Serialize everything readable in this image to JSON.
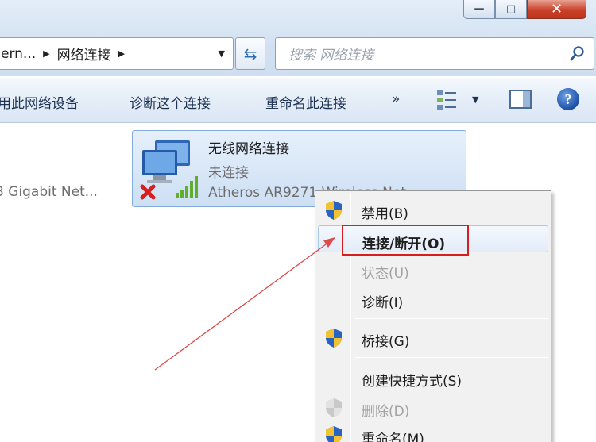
{
  "window": {
    "minimize_glyph": "—",
    "maximize_glyph": "□",
    "close_glyph": "✕"
  },
  "address": {
    "crumb_1": "ern...",
    "crumb_2": "网络连接",
    "dropdown_icon": "chevron-down-icon",
    "refresh_icon": "refresh-icon"
  },
  "search": {
    "placeholder": "搜索 网络连接",
    "icon": "search-icon"
  },
  "commandbar": {
    "items": [
      "用此网络设备",
      "诊断这个连接",
      "重命名此连接"
    ],
    "more": "»",
    "help": "?"
  },
  "content": {
    "left_item_text": "3 Gigabit Net...",
    "selected": {
      "name": "无线网络连接",
      "status": "未连接",
      "adapter": "Atheros AR9271 Wireless Net..."
    }
  },
  "context_menu": {
    "items": [
      {
        "label": "禁用(B)",
        "shield": true,
        "state": "normal"
      },
      {
        "label": "连接/断开(O)",
        "shield": false,
        "state": "default"
      },
      {
        "label": "状态(U)",
        "shield": false,
        "state": "disabled"
      },
      {
        "label": "诊断(I)",
        "shield": false,
        "state": "normal"
      },
      {
        "label": "桥接(G)",
        "shield": true,
        "state": "normal"
      },
      {
        "label": "创建快捷方式(S)",
        "shield": false,
        "state": "normal"
      },
      {
        "label": "删除(D)",
        "shield": true,
        "state": "disabled"
      },
      {
        "label": "重命名(M)",
        "shield": true,
        "state": "normal"
      }
    ]
  },
  "annotation": {
    "highlight_color": "#d61e1e",
    "arrow_color": "#e04a4a"
  },
  "colors": {
    "selection_bg": "#d6e6f7",
    "menu_bg": "#f1f1f1"
  }
}
